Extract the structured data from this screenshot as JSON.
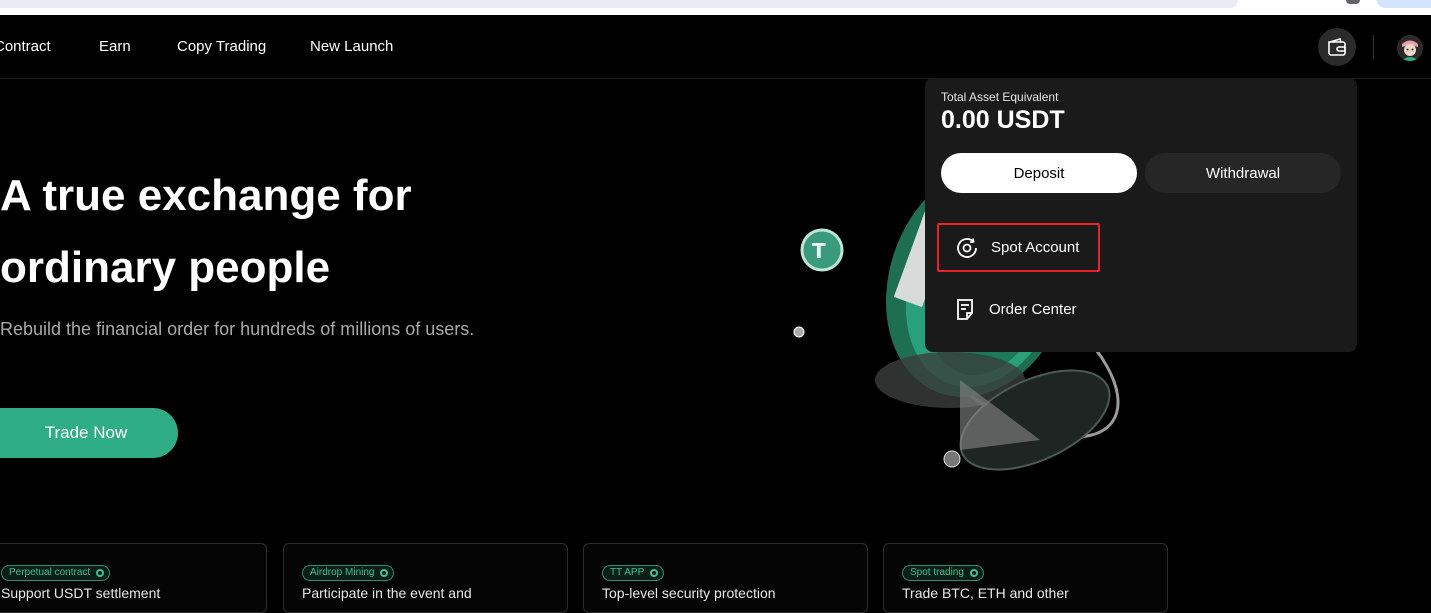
{
  "nav": {
    "items": [
      "Contract",
      "Earn",
      "Copy Trading",
      "New Launch"
    ],
    "wallet_icon": "wallet-icon",
    "avatar_icon": "avatar-icon"
  },
  "hero": {
    "title_line1": "A true exchange for",
    "title_line2": "ordinary people",
    "subtitle": "Rebuild the financial order for hundreds of millions of users.",
    "cta": "Trade Now"
  },
  "cards": [
    {
      "badge": "Perpetual contract",
      "text": "Support USDT settlement"
    },
    {
      "badge": "Airdrop Mining",
      "text": "Participate in the event and"
    },
    {
      "badge": "TT APP",
      "text": "Top-level security protection"
    },
    {
      "badge": "Spot trading",
      "text": "Trade BTC, ETH and other"
    }
  ],
  "dropdown": {
    "label": "Total Asset Equivalent",
    "amount": "0.00 USDT",
    "deposit": "Deposit",
    "withdrawal": "Withdrawal",
    "items": [
      {
        "label": "Spot Account",
        "icon": "spot-account-icon"
      },
      {
        "label": "Order Center",
        "icon": "order-center-icon"
      }
    ]
  },
  "colors": {
    "accent": "#2fae85",
    "highlight_border": "#e8212b",
    "dropdown_bg": "#1a1a1a"
  }
}
